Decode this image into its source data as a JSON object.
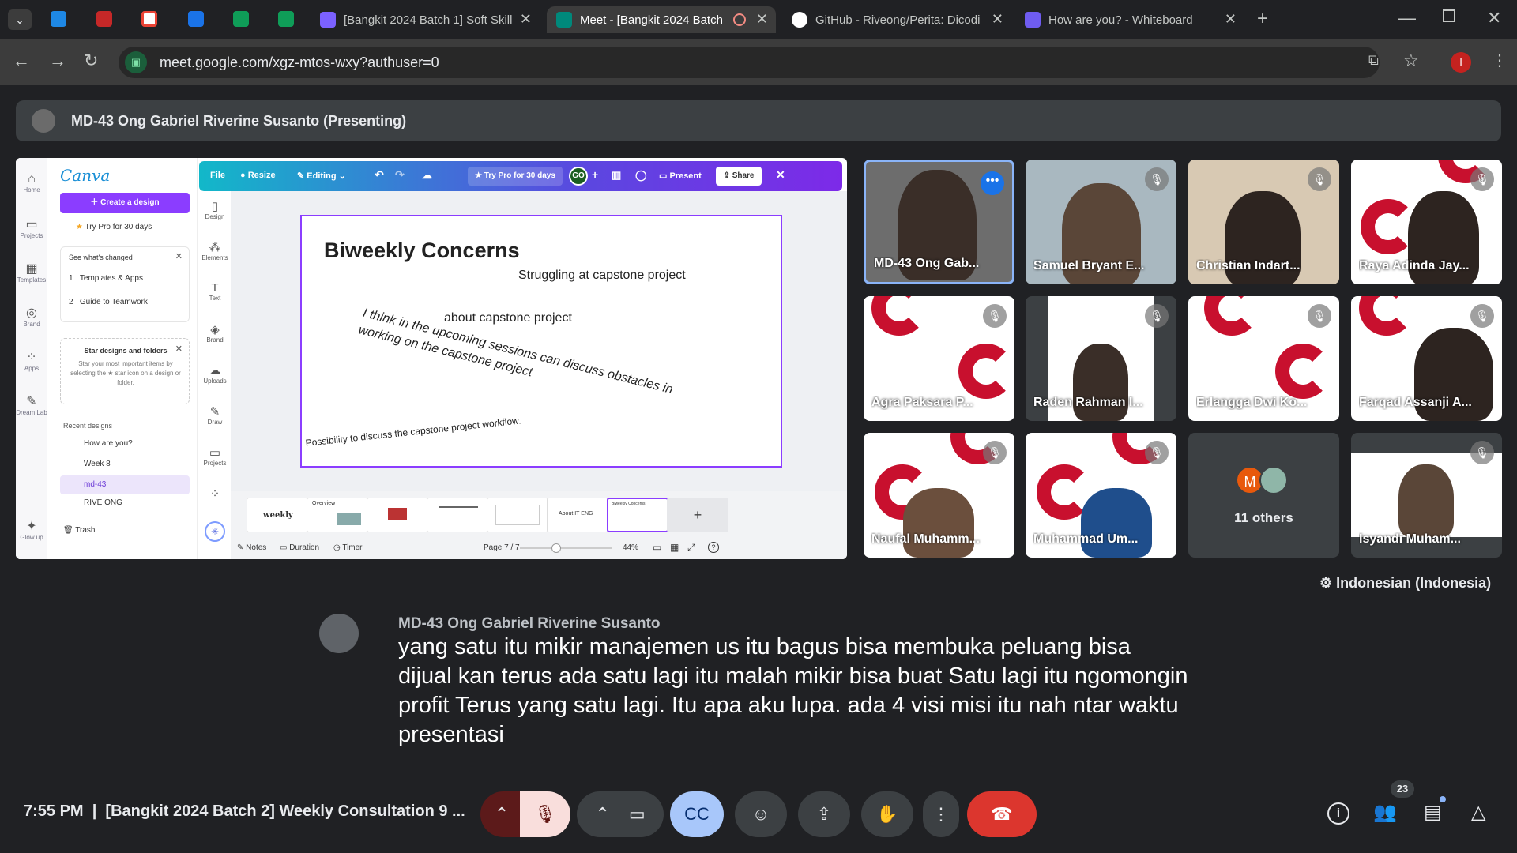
{
  "browser": {
    "tabs": [
      {
        "title": "[Bangkit 2024 Batch 1] Soft Skill",
        "color": "#7b61ff"
      },
      {
        "title": "Meet - [Bangkit 2024 Batch",
        "color": "#00897b"
      },
      {
        "title": "GitHub - Riveong/Perita: Dicodi",
        "color": "#ffffff"
      },
      {
        "title": "How are you? - Whiteboard",
        "color": "#6f5cf0"
      }
    ],
    "url": "meet.google.com/xgz-mtos-wxy?authuser=0",
    "profile_initial": "I"
  },
  "meet": {
    "presenter_label": "MD-43 Ong Gabriel Riverine Susanto (Presenting)",
    "participants": [
      "MD-43 Ong Gab...",
      "Samuel Bryant E...",
      "Christian Indart...",
      "Raya Adinda Jay...",
      "Agra Paksara P...",
      "Raden Rahman I...",
      "Erlangga Dwi Ko...",
      "Farqad Assanji A...",
      "Naufal Muhamm...",
      "Muhammad Um...",
      "Isyandi Muham..."
    ],
    "others_label": "11 others",
    "others_initial": "M",
    "caption_language": "Indonesian (Indonesia)",
    "caption_speaker": "MD-43 Ong Gabriel Riverine Susanto",
    "caption_text": "yang satu itu mikir manajemen us itu bagus bisa membuka peluang bisa dijual kan terus ada satu lagi itu malah mikir bisa buat Satu lagi itu ngomongin profit Terus yang satu lagi. Itu apa aku lupa. ada 4 visi misi itu nah ntar waktu presentasi",
    "time": "7:55 PM",
    "meeting_title": "[Bangkit 2024 Batch 2] Weekly Consultation 9 ...",
    "people_count": "23"
  },
  "canva": {
    "logo": "Canva",
    "create_button": "Create a design",
    "try_pro": "Try Pro for 30 days",
    "whats_changed": "See what's changed",
    "changes": [
      {
        "n": "1",
        "label": "Templates & Apps"
      },
      {
        "n": "2",
        "label": "Guide to Teamwork"
      }
    ],
    "star_title": "Star designs and folders",
    "star_body": "Star your most important items by selecting the ★ star icon on a design or folder.",
    "recent_title": "Recent designs",
    "recent": [
      "How are you?",
      "Week 8",
      "md-43",
      "RIVE ONG"
    ],
    "trash": "Trash",
    "rail": [
      "Home",
      "Projects",
      "Templates",
      "Brand",
      "Apps",
      "Dream Lab",
      "Glow up"
    ],
    "toolbar": {
      "file": "File",
      "resize": "Resize",
      "editing": "Editing",
      "try_pro": "Try Pro for 30 days",
      "avatar": "GO",
      "present": "Present",
      "share": "Share"
    },
    "tools": [
      "Design",
      "Elements",
      "Text",
      "Brand",
      "Uploads",
      "Draw",
      "Projects"
    ],
    "slide": {
      "title": "Biweekly Concerns",
      "line1": "Struggling at capstone project",
      "line2": "about capstone project",
      "line3": "I think in the upcoming sessions can discuss obstacles in working on the capstone project",
      "line4": "Possibility to discuss the capstone project workflow."
    },
    "thumbs": [
      "weekly",
      "Overview",
      "",
      "",
      "",
      "About IT ENG",
      "Biweekly Concerns"
    ],
    "bottom": {
      "notes": "Notes",
      "duration": "Duration",
      "timer": "Timer",
      "page": "Page 7 / 7",
      "zoom": "44%"
    }
  }
}
